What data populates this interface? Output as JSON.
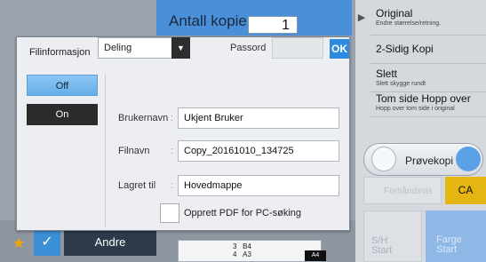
{
  "copies": {
    "label": "Antall kopier",
    "value": "1"
  },
  "right_panel": {
    "items": [
      {
        "title": "Original",
        "subtitle": "Endre størrelse/retning."
      },
      {
        "title": "2-Sidig Kopi",
        "subtitle": ""
      },
      {
        "title": "Slett",
        "subtitle": "Slett skygge rundt"
      },
      {
        "title": "Tom side Hopp over",
        "subtitle": "Hopp over tom side i original"
      }
    ],
    "preview_label": "Prøvekopi",
    "forhandsvis_label": "Forhåndsvis",
    "ca_label": "CA",
    "sh_start_label": "S/H\nStart",
    "farge_start_label": "Farge\nStart"
  },
  "bottom": {
    "andre_label": "Andre",
    "tray_rows": [
      {
        "num": "3",
        "size": "B4"
      },
      {
        "num": "4",
        "size": "A3"
      }
    ],
    "paper_badge": "A4"
  },
  "dialog": {
    "title": "Filinformasjon",
    "ok_label": "OK",
    "off_label": "Off",
    "on_label": "On",
    "share_value": "Deling",
    "password_label": "Passord",
    "username_label": "Brukernavn",
    "username_value": "Ukjent Bruker",
    "filename_label": "Filnavn",
    "filename_value": "Copy_20161010_134725",
    "saved_to_label": "Lagret til",
    "saved_to_value": "Hovedmappe",
    "pdf_checkbox_label": "Opprett PDF for PC-søking",
    "colon": ":"
  },
  "colors": {
    "accent": "#2e8ae0",
    "toggle_on": "#2b2b2b",
    "ca_yellow": "#e5b511"
  }
}
